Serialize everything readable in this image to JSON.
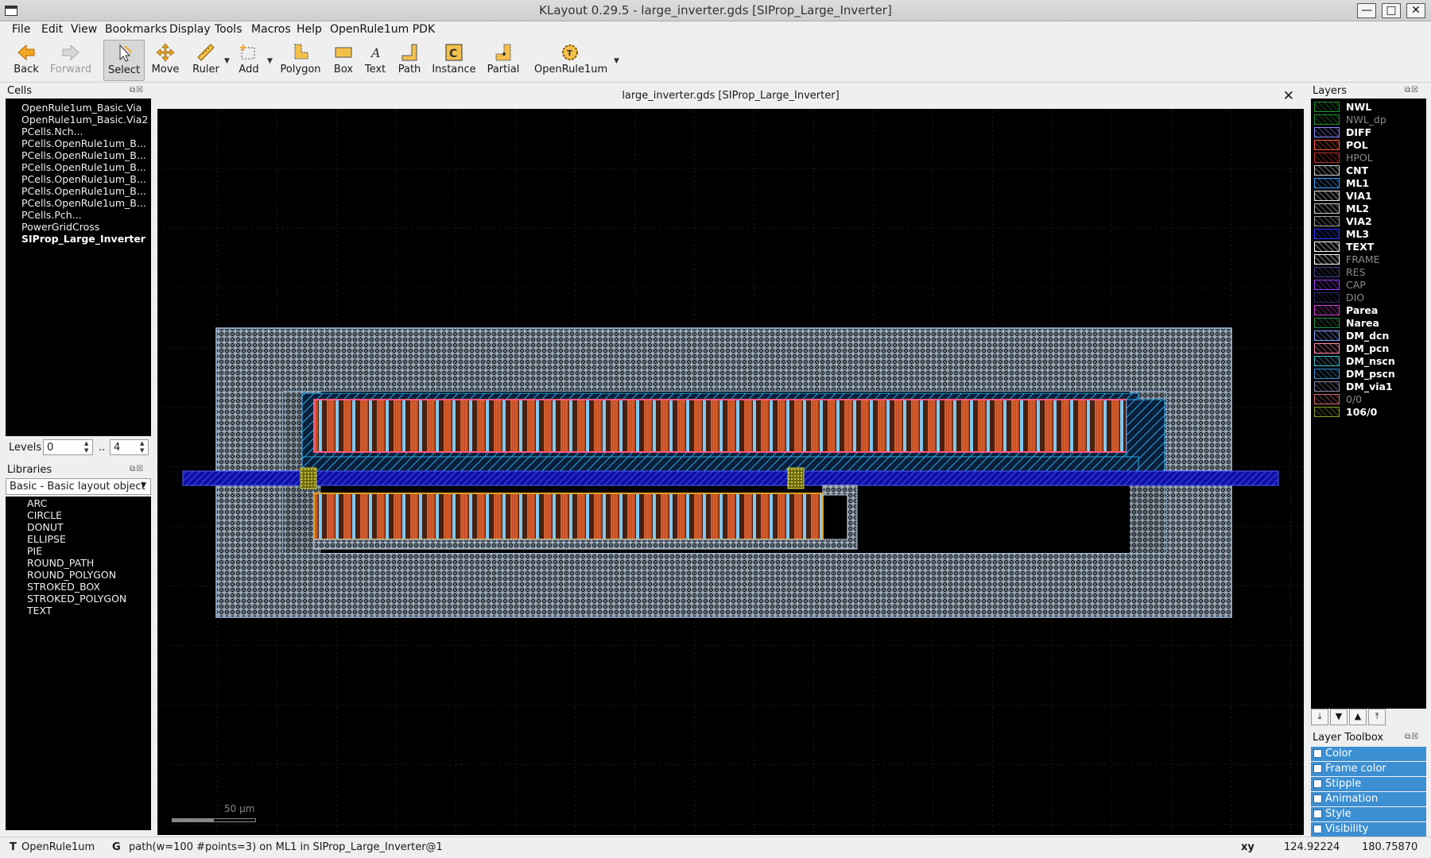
{
  "window": {
    "title": "KLayout 0.29.5 - large_inverter.gds [SIProp_Large_Inverter]",
    "minimize": "—",
    "maximize": "□",
    "close": "✕"
  },
  "menu": [
    "File",
    "Edit",
    "View",
    "Bookmarks",
    "Display",
    "Tools",
    "Macros",
    "Help",
    "OpenRule1um PDK"
  ],
  "toolbar": {
    "back": "Back",
    "forward": "Forward",
    "select": "Select",
    "move": "Move",
    "ruler": "Ruler",
    "add": "Add",
    "polygon": "Polygon",
    "box": "Box",
    "text": "Text",
    "path": "Path",
    "instance": "Instance",
    "partial": "Partial",
    "pdk": "OpenRule1um"
  },
  "cells": {
    "title": "Cells",
    "items": [
      "OpenRule1um_Basic.Via",
      "OpenRule1um_Basic.Via2",
      "PCells.Nch...",
      "PCells.OpenRule1um_B...",
      "PCells.OpenRule1um_B...",
      "PCells.OpenRule1um_B...",
      "PCells.OpenRule1um_B...",
      "PCells.OpenRule1um_B...",
      "PCells.OpenRule1um_B...",
      "PCells.Pch...",
      "PowerGridCross",
      "SIProp_Large_Inverter"
    ],
    "selected_index": 11
  },
  "levels": {
    "label": "Levels",
    "min": "0",
    "sep": "..",
    "max": "4"
  },
  "libraries": {
    "title": "Libraries",
    "selected": "Basic - Basic layout object",
    "items": [
      "ARC",
      "CIRCLE",
      "DONUT",
      "ELLIPSE",
      "PIE",
      "ROUND_PATH",
      "ROUND_POLYGON",
      "STROKED_BOX",
      "STROKED_POLYGON",
      "TEXT"
    ]
  },
  "canvas": {
    "tab_title": "large_inverter.gds [SIProp_Large_Inverter]",
    "scale_label": "50 µm"
  },
  "layers": {
    "title": "Layers",
    "items": [
      {
        "name": "NWL",
        "color": "#1f8f2f",
        "dim": false
      },
      {
        "name": "NWL_dp",
        "color": "#1f8f2f",
        "dim": true
      },
      {
        "name": "DIFF",
        "color": "#8a8aff",
        "dim": false
      },
      {
        "name": "POL",
        "color": "#ff5a3a",
        "dim": false
      },
      {
        "name": "HPOL",
        "color": "#b83030",
        "dim": true
      },
      {
        "name": "CNT",
        "color": "#d0d0d0",
        "dim": false
      },
      {
        "name": "ML1",
        "color": "#3aa0ff",
        "dim": false
      },
      {
        "name": "VIA1",
        "color": "#e0e0e0",
        "dim": false
      },
      {
        "name": "ML2",
        "color": "#c8c8c8",
        "dim": false
      },
      {
        "name": "VIA2",
        "color": "#a0a0a0",
        "dim": false
      },
      {
        "name": "ML3",
        "color": "#2a3aff",
        "dim": false
      },
      {
        "name": "TEXT",
        "color": "#ffffff",
        "dim": false
      },
      {
        "name": "FRAME",
        "color": "#ffffff",
        "dim": true
      },
      {
        "name": "RES",
        "color": "#444488",
        "dim": true
      },
      {
        "name": "CAP",
        "color": "#9a40ff",
        "dim": true
      },
      {
        "name": "DIO",
        "color": "#2a2a66",
        "dim": true
      },
      {
        "name": "Parea",
        "color": "#d040d0",
        "dim": false
      },
      {
        "name": "Narea",
        "color": "#2a8a4a",
        "dim": false
      },
      {
        "name": "DM_dcn",
        "color": "#8aa0ff",
        "dim": false
      },
      {
        "name": "DM_pcn",
        "color": "#ff8ab0",
        "dim": false
      },
      {
        "name": "DM_nscn",
        "color": "#40c0d0",
        "dim": false
      },
      {
        "name": "DM_pscn",
        "color": "#3a90d0",
        "dim": false
      },
      {
        "name": "DM_via1",
        "color": "#8a8aaa",
        "dim": false
      },
      {
        "name": "0/0",
        "color": "#d07070",
        "dim": true
      },
      {
        "name": "106/0",
        "color": "#8a9a2a",
        "dim": false
      }
    ]
  },
  "layer_toolbox": {
    "title": "Layer Toolbox",
    "items": [
      "Color",
      "Frame color",
      "Stipple",
      "Animation",
      "Style",
      "Visibility"
    ]
  },
  "status": {
    "tech_prefix": "T",
    "technology": "OpenRule1um",
    "grid_prefix": "G",
    "message": "path(w=100 #points=3) on ML1 in SIProp_Large_Inverter@1",
    "coord_label": "xy",
    "x": "124.92224",
    "y": "180.75870"
  }
}
